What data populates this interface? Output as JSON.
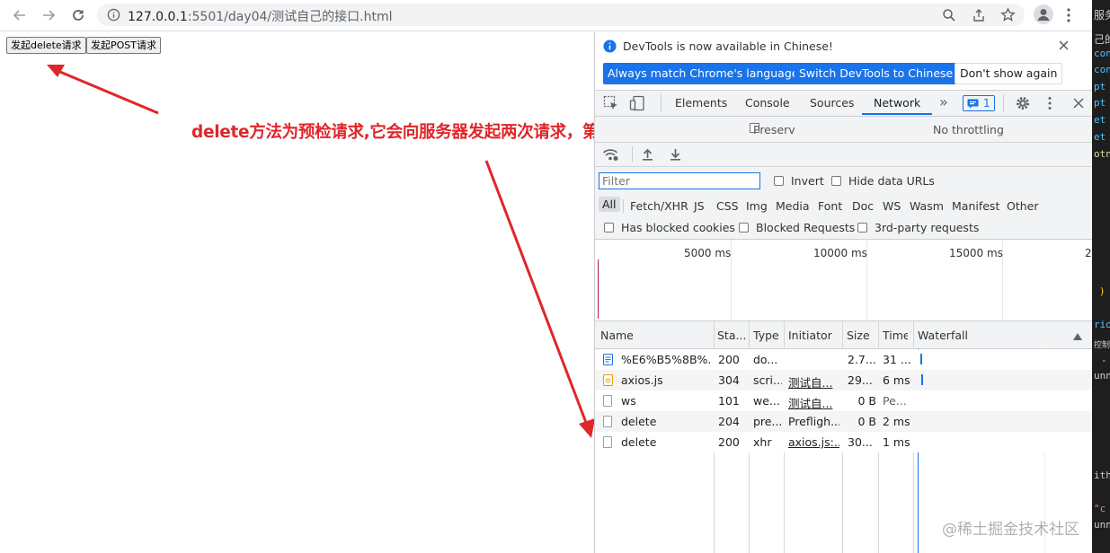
{
  "browser": {
    "url_host": "127.0.0.1",
    "url_rest": ":5501/day04/测试自己的接口.html"
  },
  "page": {
    "buttons": [
      "发起delete请求",
      "发起POST请求"
    ],
    "annotation": "delete方法为预检请求,它会向服务器发起两次请求，第一次不传文件，检测是否有这接口，第二次才传数据"
  },
  "devtools": {
    "banner": {
      "message": "DevTools is now available in Chinese!",
      "btn_match": "Always match Chrome's language",
      "btn_switch": "Switch DevTools to Chinese",
      "btn_dont": "Don't show again"
    },
    "tabs": [
      "Elements",
      "Console",
      "Sources",
      "Network"
    ],
    "issues_count": "1",
    "toolbar": {
      "preserve": "Preserv",
      "throttling": "No throttling"
    },
    "filter": {
      "placeholder": "Filter",
      "invert": "Invert",
      "hide_urls": "Hide data URLs",
      "types": [
        "All",
        "Fetch/XHR",
        "JS",
        "CSS",
        "Img",
        "Media",
        "Font",
        "Doc",
        "WS",
        "Wasm",
        "Manifest",
        "Other"
      ],
      "blocked_cookies": "Has blocked cookies",
      "blocked_requests": "Blocked Requests",
      "third_party": "3rd-party requests"
    },
    "overview_ticks": [
      "5000 ms",
      "10000 ms",
      "15000 ms",
      "2"
    ],
    "columns": [
      "Name",
      "Sta...",
      "Type",
      "Initiator",
      "Size",
      "Time",
      "Waterfall"
    ],
    "rows": [
      {
        "name": "%E6%B5%8B%...",
        "status": "200",
        "type": "do...",
        "initiator": "",
        "size": "2.7...",
        "time": "31 ..."
      },
      {
        "name": "axios.js",
        "status": "304",
        "type": "scri...",
        "initiator": "测试自...",
        "size": "29...",
        "time": "6 ms"
      },
      {
        "name": "ws",
        "status": "101",
        "type": "we...",
        "initiator": "测试自...",
        "size": "0 B",
        "time": "Pe..."
      },
      {
        "name": "delete",
        "status": "204",
        "type": "pre...",
        "initiator": "Prefligh...",
        "size": "0 B",
        "time": "2 ms"
      },
      {
        "name": "delete",
        "status": "200",
        "type": "xhr",
        "initiator": "axios.js:...",
        "size": "30...",
        "time": "1 ms"
      }
    ]
  },
  "editor": {
    "lines": [
      "服务",
      "己的",
      "con",
      "con",
      "pt",
      "pt",
      "et",
      "et",
      "otn",
      ")",
      "rio",
      "控制",
      "-",
      "unn",
      "ith",
      "\"c",
      "unn"
    ]
  },
  "watermark": "@稀土掘金技术社区",
  "colors": {
    "annotation": "#e0262a",
    "devtools_blue": "#1a73e8"
  }
}
